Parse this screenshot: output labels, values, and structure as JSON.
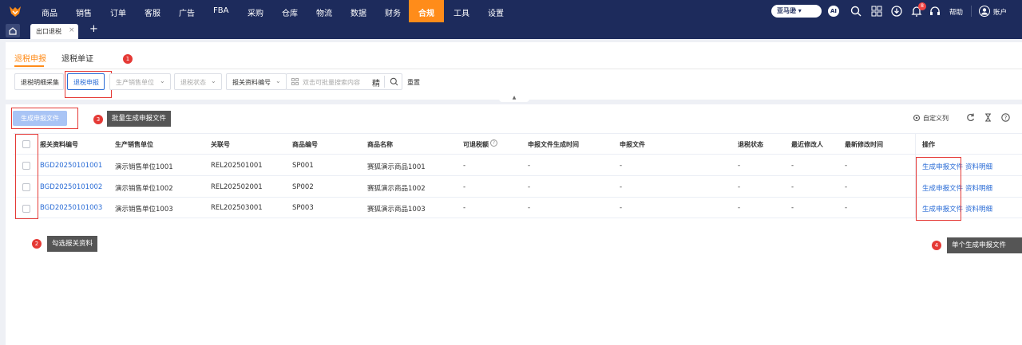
{
  "nav": {
    "items": [
      "商品",
      "销售",
      "订单",
      "客服",
      "广告",
      "FBA",
      "采购",
      "仓库",
      "物流",
      "数据",
      "财务",
      "合规",
      "工具",
      "设置"
    ],
    "active": "合规",
    "marketplace": "亚马逊",
    "ai": "AI",
    "notif_count": "8",
    "help": "帮助",
    "account": "账户"
  },
  "tabs": {
    "active": "出口退税",
    "close": "×",
    "add": "+"
  },
  "page_tabs": [
    "退税申报",
    "退税单证"
  ],
  "filters": {
    "collect": "退税明细采集",
    "declare": "退税申报",
    "seller_placeholder": "生产销售单位",
    "status_placeholder": "退税状态",
    "doc_no": "报关资料编号",
    "search_placeholder": "双击可批量搜索内容",
    "precise": "精",
    "reset": "重置"
  },
  "toolbar": {
    "generate": "生成申报文件",
    "custom_columns": "自定义列"
  },
  "annotations": {
    "m1": "1",
    "m2": "2",
    "m3": "3",
    "m4": "4",
    "t2": "勾选报关资料",
    "t3": "批量生成申报文件",
    "t4": "单个生成申报文件"
  },
  "table": {
    "headers": [
      "报关资料编号",
      "生产销售单位",
      "关联号",
      "商品编号",
      "商品名称",
      "可退税额",
      "申报文件生成时间",
      "申报文件",
      "退税状态",
      "最近修改人",
      "最新修改时间",
      "操作"
    ],
    "rows": [
      {
        "doc_no": "BGD20250101001",
        "seller": "演示销售单位1001",
        "ref": "REL202501001",
        "sku": "SP001",
        "name": "赛狐演示商品1001",
        "refund": "-",
        "gen_time": "-",
        "file": "-",
        "status": "-",
        "modifier": "-",
        "mod_time": "-"
      },
      {
        "doc_no": "BGD20250101002",
        "seller": "演示销售单位1002",
        "ref": "REL202502001",
        "sku": "SP002",
        "name": "赛狐演示商品1002",
        "refund": "-",
        "gen_time": "-",
        "file": "-",
        "status": "-",
        "modifier": "-",
        "mod_time": "-"
      },
      {
        "doc_no": "BGD20250101003",
        "seller": "演示销售单位1003",
        "ref": "REL202503001",
        "sku": "SP003",
        "name": "赛狐演示商品1003",
        "refund": "-",
        "gen_time": "-",
        "file": "-",
        "status": "-",
        "modifier": "-",
        "mod_time": "-"
      }
    ],
    "actions": {
      "generate": "生成申报文件",
      "detail": "资料明细"
    }
  },
  "icons": [
    "logo-icon",
    "search-icon",
    "grid-icon",
    "download-icon",
    "bell-icon",
    "headset-icon",
    "user-icon",
    "home-icon",
    "gear-icon",
    "refresh-icon",
    "hourglass-icon",
    "help-icon",
    "chevron-down-icon",
    "scan-icon",
    "question-icon",
    "caret-up-icon"
  ],
  "colors": {
    "nav_bg": "#1d2b5c",
    "accent": "#ff8c1a",
    "link": "#2a6cd6",
    "annotation": "#e53935"
  }
}
